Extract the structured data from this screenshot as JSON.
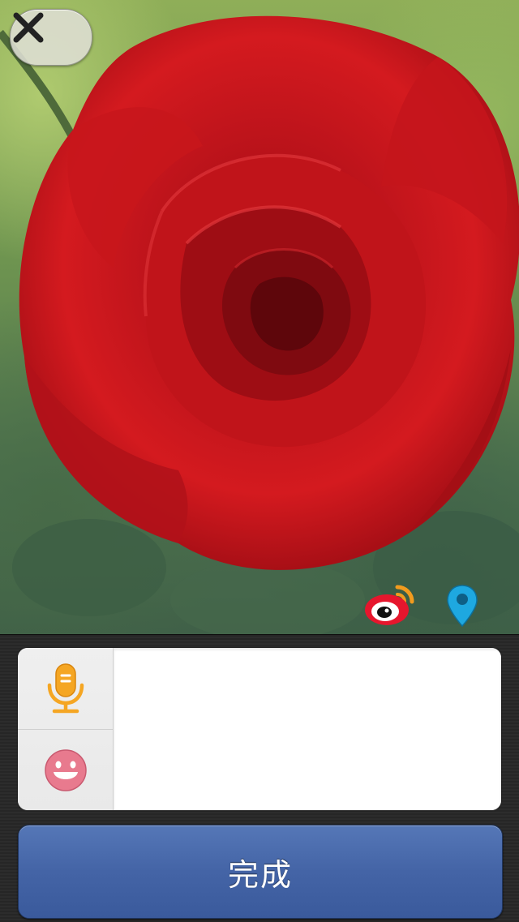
{
  "toolbar": {
    "close_icon": "close-icon",
    "share_icon": "weibo-icon",
    "location_icon": "location-pin-icon"
  },
  "compose": {
    "text_value": "",
    "voice_icon": "microphone-icon",
    "emoji_icon": "smiley-icon"
  },
  "actions": {
    "done_label": "完成"
  },
  "colors": {
    "done_button": "#4464a6",
    "microphone": "#f5a623",
    "smiley": "#e87a8e",
    "location_pin": "#1ea8e0",
    "weibo": "#e6162d"
  }
}
